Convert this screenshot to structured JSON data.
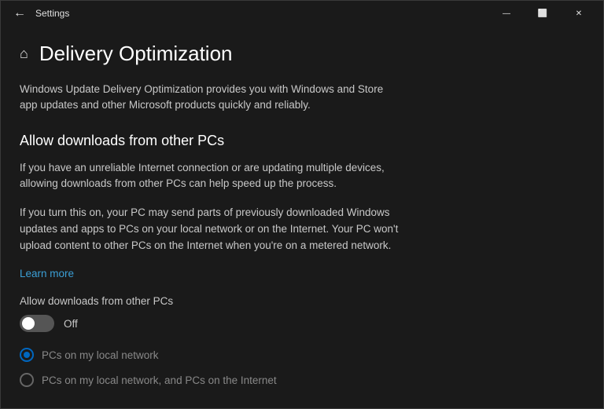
{
  "titlebar": {
    "title": "Settings",
    "minimize_label": "—",
    "maximize_label": "⬜",
    "close_label": "✕"
  },
  "page": {
    "title": "Delivery Optimization",
    "description": "Windows Update Delivery Optimization provides you with Windows and Store app updates and other Microsoft products quickly and reliably.",
    "section_title": "Allow downloads from other PCs",
    "info_text_1": "If you have an unreliable Internet connection or are updating multiple devices, allowing downloads from other PCs can help speed up the process.",
    "info_text_2": "If you turn this on, your PC may send parts of previously downloaded Windows updates and apps to PCs on your local network or on the Internet. Your PC won't upload content to other PCs on the Internet when you're on a metered network.",
    "learn_more": "Learn more",
    "allow_label": "Allow downloads from other PCs",
    "toggle_status": "Off",
    "toggle_state": "off",
    "radio_options": [
      {
        "label": "PCs on my local network",
        "selected": true
      },
      {
        "label": "PCs on my local network, and PCs on the Internet",
        "selected": false
      }
    ]
  }
}
